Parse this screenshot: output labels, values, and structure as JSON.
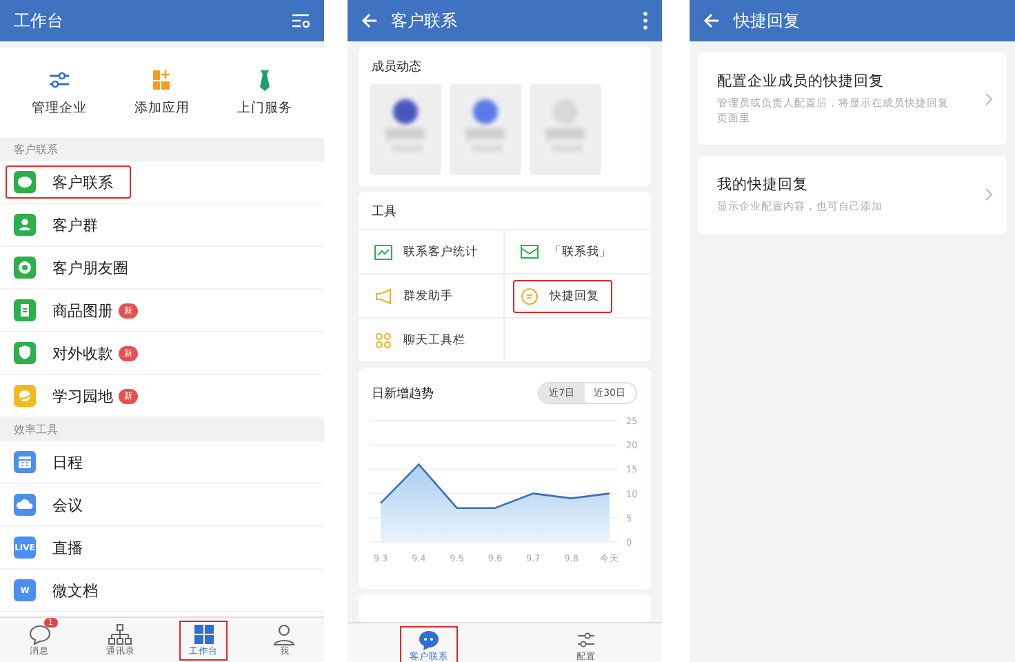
{
  "workbench": {
    "title": "工作台",
    "quick_actions": [
      {
        "label": "管理企业",
        "color": "#2f6fd0"
      },
      {
        "label": "添加应用",
        "color": "#f0a020"
      },
      {
        "label": "上门服务",
        "color": "#1aa06a"
      }
    ],
    "sections": [
      {
        "label": "客户联系",
        "items": [
          {
            "label": "客户联系",
            "color": "#2bb04a",
            "highlighted": true
          },
          {
            "label": "客户群",
            "color": "#2bb04a",
            "highlighted": false
          },
          {
            "label": "客户朋友圈",
            "color": "#2bb04a",
            "highlighted": false
          },
          {
            "label": "商品图册",
            "color": "#2bb04a",
            "badge": "新",
            "highlighted": false
          },
          {
            "label": "对外收款",
            "color": "#2bb04a",
            "badge": "新",
            "highlighted": false
          },
          {
            "label": "学习园地",
            "color": "#f5b820",
            "badge": "新",
            "highlighted": false
          }
        ]
      },
      {
        "label": "效率工具",
        "items": [
          {
            "label": "日程",
            "color": "#4a8ff0",
            "highlighted": false
          },
          {
            "label": "会议",
            "color": "#4a8ff0",
            "highlighted": false
          },
          {
            "label": "直播",
            "color": "#4a8ff0",
            "icon_text": "LIVE",
            "highlighted": false
          },
          {
            "label": "微文档",
            "color": "#4a8ff0",
            "icon_text": "W",
            "highlighted": false
          }
        ]
      }
    ],
    "tab_bar": [
      {
        "label": "消息",
        "badge": "1",
        "selected": false,
        "highlighted": false
      },
      {
        "label": "通讯录",
        "selected": false,
        "highlighted": false
      },
      {
        "label": "工作台",
        "selected": true,
        "highlighted": true
      },
      {
        "label": "我",
        "selected": false,
        "highlighted": false
      }
    ]
  },
  "customer_contact": {
    "title": "客户联系",
    "members_title": "成员动态",
    "members": [
      {
        "kind": "blurred",
        "color": "#4a56c0"
      },
      {
        "kind": "blurred",
        "color": "#5a7ae8"
      },
      {
        "kind": "blurred",
        "color": "#d8d8d8"
      }
    ],
    "tools_title": "工具",
    "tools": [
      {
        "label": "联系客户统计",
        "color": "#2bb04a",
        "highlighted": false
      },
      {
        "label": "「联系我」",
        "color": "#2bb04a",
        "highlighted": false
      },
      {
        "label": "群发助手",
        "color": "#f0b020",
        "highlighted": false
      },
      {
        "label": "快捷回复",
        "color": "#f0b020",
        "highlighted": true
      },
      {
        "label": "聊天工具栏",
        "color": "#f0b020",
        "highlighted": false
      }
    ],
    "trend": {
      "title": "日新增趋势",
      "ranges": [
        {
          "label": "近7日",
          "selected": true
        },
        {
          "label": "近30日",
          "selected": false
        }
      ],
      "chart_data": {
        "type": "area",
        "categories": [
          "9.3",
          "9.4",
          "9.5",
          "9.6",
          "9.7",
          "9.8",
          "今天"
        ],
        "series": [
          {
            "color": "#3a6fb8",
            "values": [
              8,
              16,
              7,
              7,
              10,
              9,
              10
            ]
          }
        ],
        "ylim": [
          0,
          25
        ],
        "yticks": [
          0,
          5,
          10,
          15,
          20,
          25
        ],
        "grid": true
      }
    },
    "tab_bar": [
      {
        "label": "客户联系",
        "selected": true,
        "highlighted": true
      },
      {
        "label": "配置",
        "selected": false,
        "highlighted": false
      }
    ]
  },
  "quick_reply": {
    "title": "快捷回复",
    "options": [
      {
        "title": "配置企业成员的快捷回复",
        "description": "管理员或负责人配置后，将显示在成员快捷回复页面里"
      },
      {
        "title": "我的快捷回复",
        "description": "显示企业配置内容，也可自己添加"
      }
    ]
  }
}
